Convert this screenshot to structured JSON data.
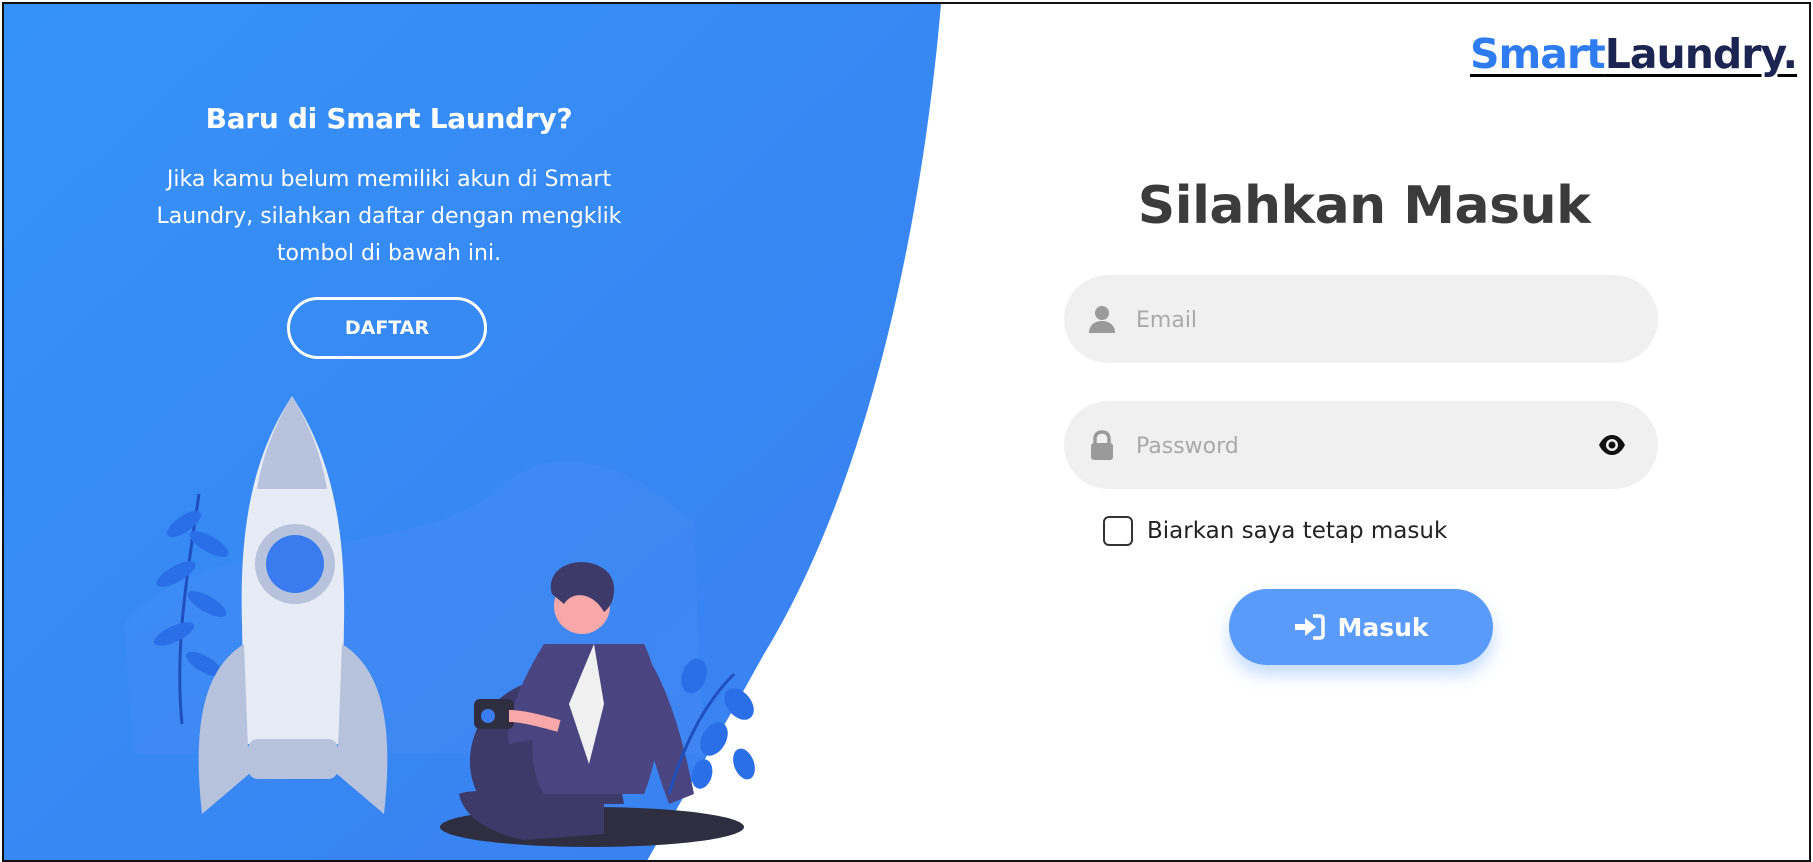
{
  "brand": {
    "part1": "Smart",
    "part2": "Laundry."
  },
  "register_panel": {
    "title": "Baru di Smart Laundry?",
    "description_lines": [
      "Jika kamu belum memiliki akun di Smart",
      "Laundry, silahkan daftar dengan mengklik",
      "tombol di bawah ini."
    ],
    "register_button": "DAFTAR"
  },
  "login": {
    "title": "Silahkan Masuk",
    "email": {
      "placeholder": "Email",
      "value": "",
      "icon": "user-icon"
    },
    "password": {
      "placeholder": "Password",
      "value": "",
      "icon": "lock-icon",
      "toggle_icon": "eye-icon"
    },
    "remember_label": "Biarkan saya tetap masuk",
    "remember_checked": false,
    "submit_label": "Masuk",
    "submit_icon": "sign-in-icon"
  },
  "colors": {
    "panel_blue": "#3a8ef6",
    "brand_blue": "#2f7bf0",
    "brand_dark": "#1c2452",
    "button_blue": "#5a9bfa",
    "field_bg": "#f0f0f0"
  }
}
